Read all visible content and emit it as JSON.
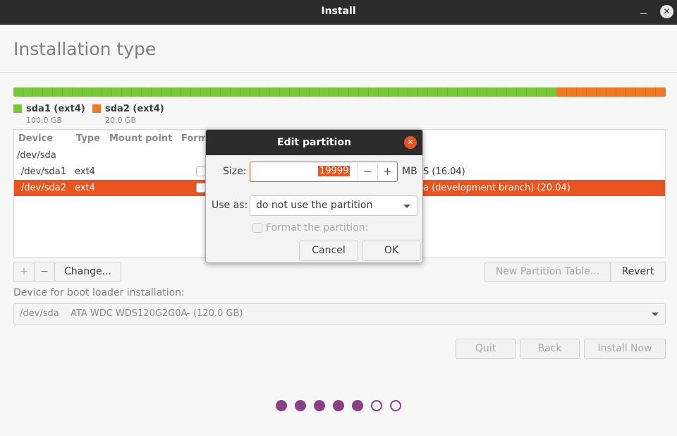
{
  "window": {
    "title": "Install"
  },
  "page": {
    "title": "Installation type"
  },
  "partitions_bar": [
    {
      "name": "sda1 (ext4)",
      "size": "100.0 GB",
      "color": "#78c83a"
    },
    {
      "name": "sda2 (ext4)",
      "size": "20.0 GB",
      "color": "#ee7a26"
    }
  ],
  "table": {
    "headers": [
      "Device",
      "Type",
      "Mount point",
      "Form"
    ],
    "rows": [
      {
        "device": "/dev/sda",
        "type": "",
        "system": ""
      },
      {
        "device": "/dev/sda1",
        "type": "ext4",
        "system": "S (16.04)"
      },
      {
        "device": "/dev/sda2",
        "type": "ext4",
        "system": "a (development branch) (20.04)"
      }
    ]
  },
  "table_buttons": {
    "add": "+",
    "remove": "−",
    "change": "Change...",
    "new_table": "New Partition Table...",
    "revert": "Revert"
  },
  "bootloader": {
    "label": "Device for boot loader installation:",
    "device": "/dev/sda",
    "description": "ATA WDC WDS120G2G0A- (120.0 GB)"
  },
  "nav_buttons": {
    "quit": "Quit",
    "back": "Back",
    "install": "Install Now"
  },
  "progress": {
    "total_steps": 7,
    "current_step": 5
  },
  "dialog": {
    "title": "Edit partition",
    "size_label": "Size:",
    "size_value": "19999",
    "size_unit": "MB",
    "use_as_label": "Use as:",
    "use_as_value": "do not use the partition",
    "format_label": "Format the partition:",
    "cancel": "Cancel",
    "ok": "OK"
  },
  "colors": {
    "accent": "#e95420",
    "titlebar": "#2c2c2c",
    "progress_dot": "#77216f"
  }
}
